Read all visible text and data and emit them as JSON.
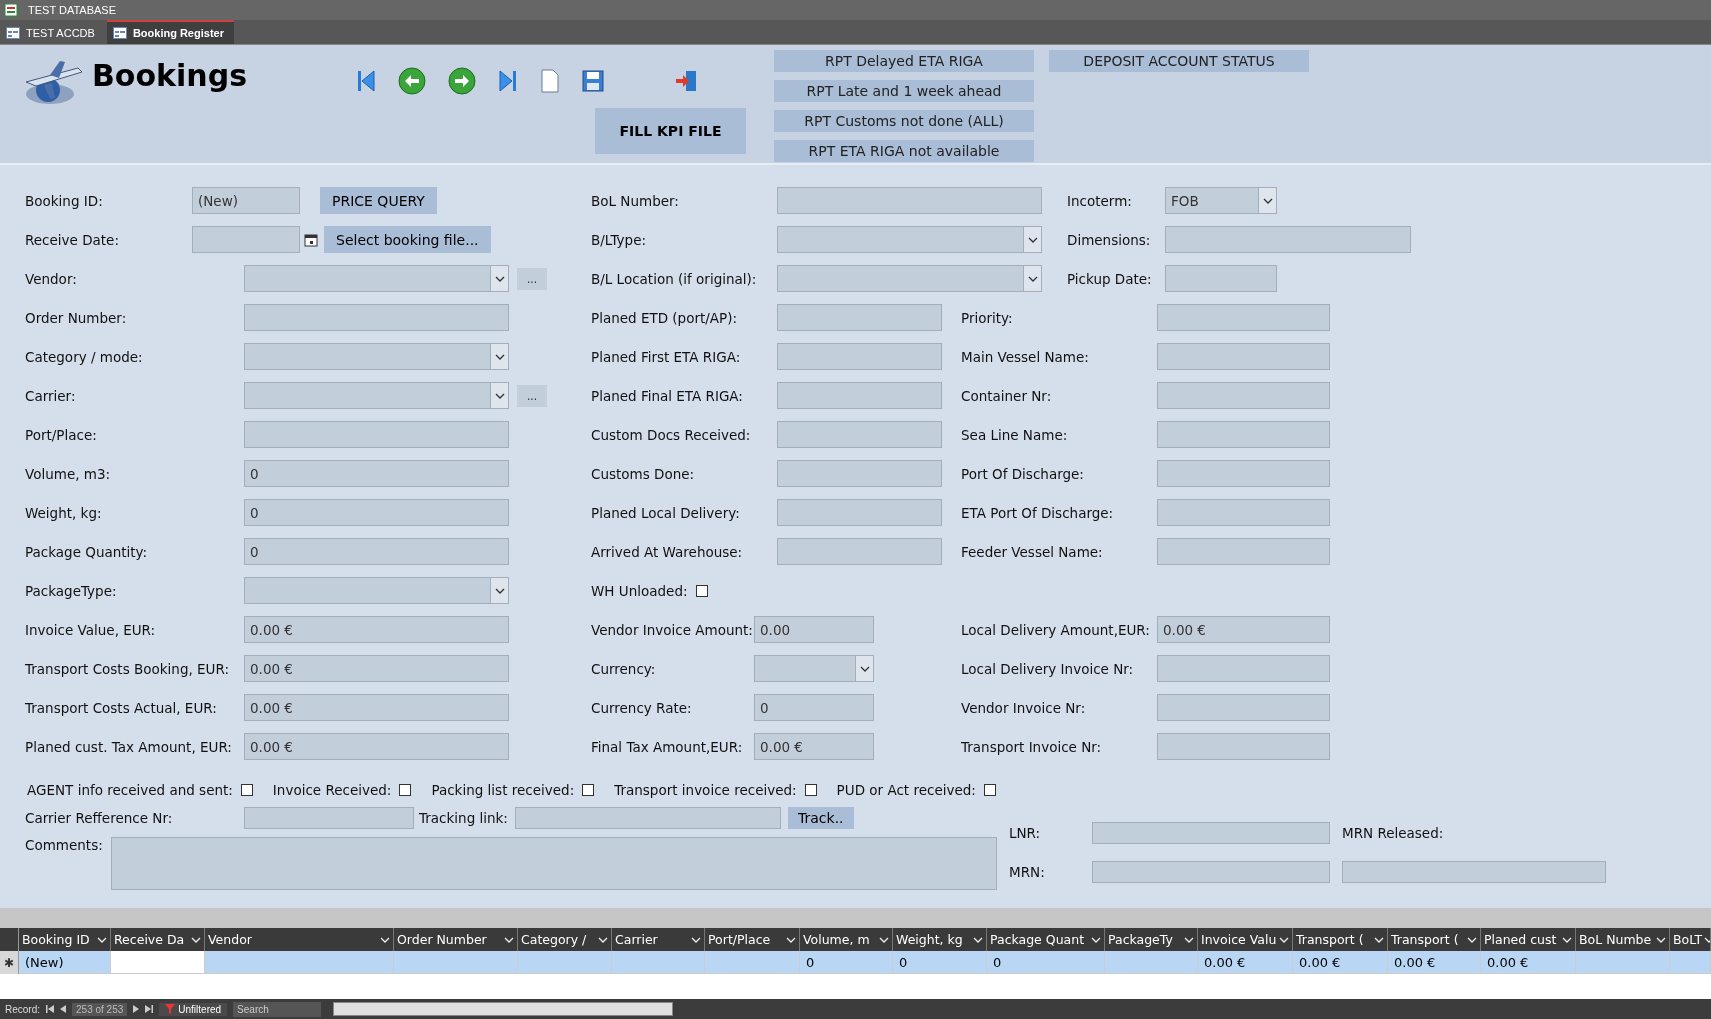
{
  "app_title": "TEST DATABASE",
  "doc_tabs": [
    {
      "label": "TEST ACCDB",
      "selected": false
    },
    {
      "label": "Booking Register",
      "selected": true
    }
  ],
  "header": {
    "title": "Bookings",
    "fill_kpi": "FILL KPI FILE",
    "deposit_button": "DEPOSIT ACCOUNT STATUS",
    "report_buttons": [
      "RPT Delayed ETA RIGA",
      "RPT Late and 1 week ahead",
      "RPT Customs not done (ALL)",
      "RPT ETA RIGA not available"
    ]
  },
  "id_fields": [
    {
      "label": "Booking ID:",
      "kind": "text",
      "value": "(New)",
      "button": "PRICE QUERY"
    },
    {
      "label": "Receive Date:",
      "kind": "date",
      "button": "Select booking file..."
    }
  ],
  "main_fields": [
    {
      "label": "Vendor:",
      "kind": "combo",
      "more": "..."
    },
    {
      "label": "Order Number:",
      "kind": "text"
    },
    {
      "label": "Category / mode:",
      "kind": "combo"
    },
    {
      "label": "Carrier:",
      "kind": "combo",
      "more": "..."
    },
    {
      "label": "Port/Place:",
      "kind": "text"
    },
    {
      "label": "Volume, m3:",
      "kind": "text",
      "value": "0"
    },
    {
      "label": "Weight, kg:",
      "kind": "text",
      "value": "0"
    },
    {
      "label": "Package Quantity:",
      "kind": "text",
      "value": "0"
    },
    {
      "label": "PackageType:",
      "kind": "combo"
    },
    {
      "label": "Invoice Value, EUR:",
      "kind": "text",
      "value": "0.00 €"
    },
    {
      "label": "Transport Costs Booking, EUR:",
      "kind": "text",
      "value": "0.00 €"
    },
    {
      "label": "Transport Costs Actual, EUR:",
      "kind": "text",
      "value": "0.00 €"
    },
    {
      "label": "Planed cust. Tax Amount, EUR:",
      "kind": "text",
      "value": "0.00 €"
    }
  ],
  "bol_fields": [
    {
      "label": "BoL Number:",
      "kind": "text"
    },
    {
      "label": "B/LType:",
      "kind": "combo"
    },
    {
      "label": "B/L Location (if original):",
      "kind": "combo"
    }
  ],
  "date_fields": [
    {
      "label": "Planed ETD (port/AP):",
      "kind": "text"
    },
    {
      "label": "Planed First ETA RIGA:",
      "kind": "text"
    },
    {
      "label": "Planed Final ETA RIGA:",
      "kind": "text"
    },
    {
      "label": "Custom Docs Received:",
      "kind": "text"
    },
    {
      "label": "Customs Done:",
      "kind": "text"
    },
    {
      "label": "Planed Local Delivery:",
      "kind": "text"
    },
    {
      "label": "Arrived At Warehouse:",
      "kind": "text"
    }
  ],
  "payment_fields": [
    {
      "label": "WH Unloaded:",
      "kind": "checkbox",
      "checked": false
    },
    {
      "label": "Vendor Invoice Amount:",
      "kind": "text",
      "value": "0.00"
    },
    {
      "label": "Currency:",
      "kind": "combo"
    },
    {
      "label": "Currency Rate:",
      "kind": "text",
      "value": "0"
    },
    {
      "label": "Final Tax Amount,EUR:",
      "kind": "text",
      "value": "0.00 €"
    }
  ],
  "terms_fields": [
    {
      "label": "Incoterm:",
      "kind": "combo",
      "value": "FOB"
    },
    {
      "label": "Dimensions:",
      "kind": "text"
    },
    {
      "label": "Pickup Date:",
      "kind": "text"
    }
  ],
  "vessel_fields": [
    {
      "label": "Priority:",
      "kind": "text"
    },
    {
      "label": "Main Vessel Name:",
      "kind": "text"
    },
    {
      "label": "Container Nr:",
      "kind": "text"
    },
    {
      "label": "Sea Line Name:",
      "kind": "text"
    },
    {
      "label": "Port Of Discharge:",
      "kind": "text"
    },
    {
      "label": "ETA Port Of Discharge:",
      "kind": "text"
    },
    {
      "label": "Feeder Vessel Name:",
      "kind": "text"
    }
  ],
  "delivery_fields": [
    {
      "label": "Local Delivery Amount,EUR:",
      "kind": "text",
      "value": "0.00 €"
    },
    {
      "label": "Local Delivery Invoice Nr:",
      "kind": "text"
    },
    {
      "label": "Vendor Invoice Nr:",
      "kind": "text"
    },
    {
      "label": "Transport Invoice Nr:",
      "kind": "text"
    }
  ],
  "checkboxes": [
    {
      "label": "AGENT info received and sent:",
      "checked": false
    },
    {
      "label": "Invoice Received:",
      "checked": false
    },
    {
      "label": "Packing list received:",
      "checked": false
    },
    {
      "label": "Transport invoice received:",
      "checked": false
    },
    {
      "label": "PUD or Act received:",
      "checked": false
    }
  ],
  "tracking": {
    "carrier_ref_label": "Carrier Refference Nr:",
    "tracking_label": "Tracking link:",
    "track_button": "Track.."
  },
  "comments_label": "Comments:",
  "customs": {
    "lnr_label": "LNR:",
    "mrn_label": "MRN:",
    "mrn_released_label": "MRN Released:"
  },
  "grid": {
    "new_row_marker": "✱",
    "columns": [
      {
        "label": "Booking ID",
        "value": "(New)"
      },
      {
        "label": "Receive Da"
      },
      {
        "label": "Vendor"
      },
      {
        "label": "Order Number"
      },
      {
        "label": "Category /"
      },
      {
        "label": "Carrier"
      },
      {
        "label": "Port/Place"
      },
      {
        "label": "Volume, m",
        "value": "0"
      },
      {
        "label": "Weight, kg",
        "value": "0"
      },
      {
        "label": "Package Quant",
        "value": "0"
      },
      {
        "label": "PackageTy"
      },
      {
        "label": "Invoice Valu",
        "value": "0.00 €"
      },
      {
        "label": "Transport (",
        "value": "0.00 €"
      },
      {
        "label": "Transport (",
        "value": "0.00 €"
      },
      {
        "label": "Planed cust",
        "value": "0.00 €"
      },
      {
        "label": "BoL Numbe"
      },
      {
        "label": "BoLT"
      }
    ]
  },
  "record_nav": {
    "label": "Record:",
    "position": "253 of 253",
    "filter": "Unfiltered",
    "search_placeholder": "Search"
  }
}
